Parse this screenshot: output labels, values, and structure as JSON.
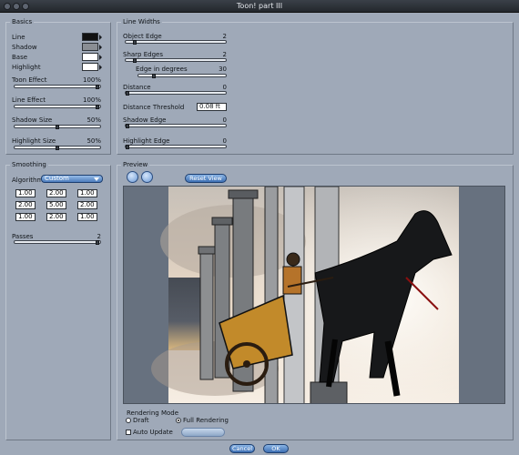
{
  "window": {
    "title": "Toon! part III"
  },
  "basics": {
    "title": "Basics",
    "line_label": "Line",
    "shadow_label": "Shadow",
    "base_label": "Base",
    "highlight_label": "Highlight",
    "line_color": "#111111",
    "shadow_color": "#8a8e94",
    "base_color": "#ffffff",
    "highlight_color": "#ffffff",
    "toon_effect": {
      "label": "Toon Effect",
      "value": "100%",
      "level": 1.0
    },
    "line_effect": {
      "label": "Line Effect",
      "value": "100%",
      "level": 1.0
    },
    "shadow_size": {
      "label": "Shadow Size",
      "value": "50%",
      "level": 0.5
    },
    "highlight_size": {
      "label": "Highlight Size",
      "value": "50%",
      "level": 0.5
    }
  },
  "line_widths": {
    "title": "Line Widths",
    "object_edge": {
      "label": "Object Edge",
      "value": "2",
      "level": 0.08
    },
    "sharp_edges": {
      "label": "Sharp Edges",
      "value": "2",
      "level": 0.08
    },
    "edge_degrees": {
      "label": "Edge in degrees",
      "value": "30",
      "level": 0.17
    },
    "distance": {
      "label": "Distance",
      "value": "0",
      "level": 0.0
    },
    "distance_threshold": {
      "label": "Distance Threshold",
      "value": "0.08 ft"
    },
    "shadow_edge": {
      "label": "Shadow Edge",
      "value": "0",
      "level": 0.0
    },
    "highlight_edge": {
      "label": "Highlight Edge",
      "value": "0",
      "level": 0.0
    }
  },
  "smoothing": {
    "title": "Smoothing",
    "algorithm_label": "Algorithm",
    "algorithm_value": "Custom",
    "matrix": [
      [
        "1.00",
        "2.00",
        "1.00"
      ],
      [
        "2.00",
        "5.00",
        "2.00"
      ],
      [
        "1.00",
        "2.00",
        "1.00"
      ]
    ],
    "passes": {
      "label": "Passes",
      "value": "2",
      "level": 1.0
    }
  },
  "preview": {
    "title": "Preview",
    "reset_label": "Reset View",
    "rendering_mode_label": "Rendering Mode",
    "draft_label": "Draft",
    "full_label": "Full Rendering",
    "auto_update_label": "Auto Update",
    "draft_selected": false,
    "full_selected": true,
    "auto_update_checked": false
  },
  "footer": {
    "cancel_label": "Cancel",
    "ok_label": "OK"
  }
}
